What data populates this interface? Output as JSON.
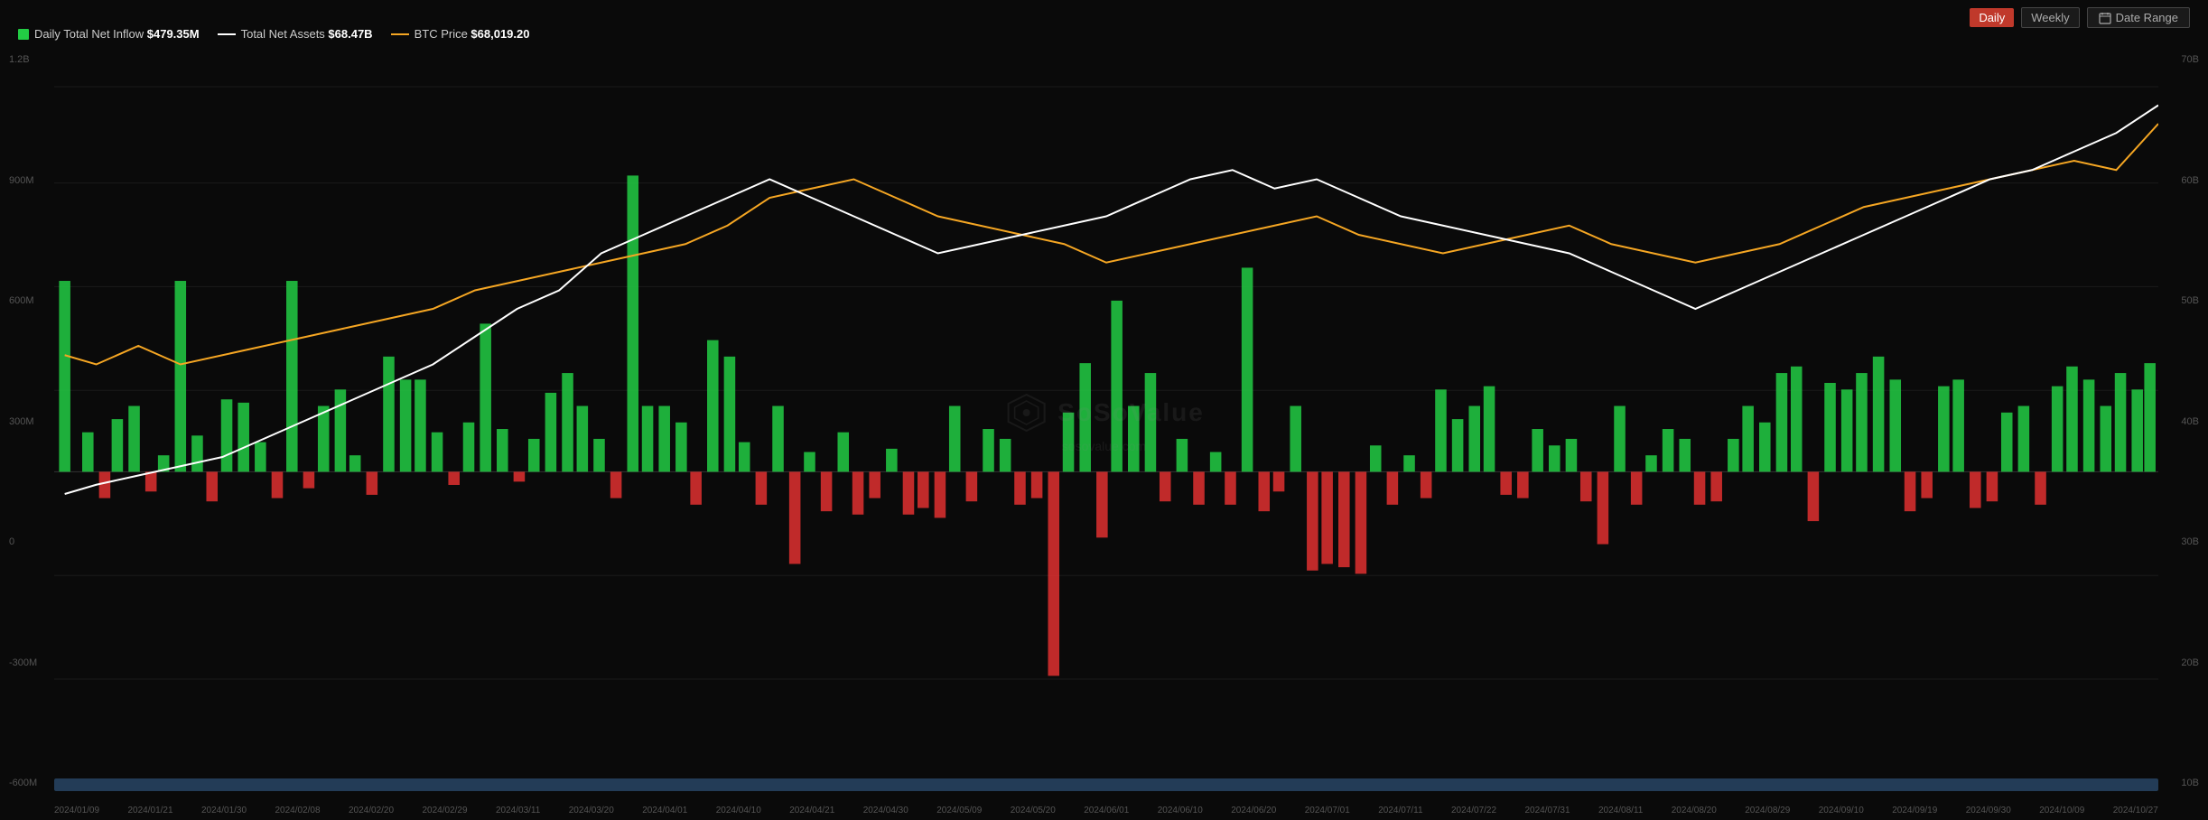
{
  "header": {
    "legend": [
      {
        "id": "inflow",
        "type": "dot",
        "color": "#22cc44",
        "label": "Daily Total Net Inflow",
        "value": "$479.35M"
      },
      {
        "id": "assets",
        "type": "line",
        "color": "#ffffff",
        "label": "Total Net Assets",
        "value": "$68.47B"
      },
      {
        "id": "btc",
        "type": "line",
        "color": "#f5a623",
        "label": "BTC Price",
        "value": "$68,019.20"
      }
    ],
    "controls": {
      "daily": "Daily",
      "weekly": "Weekly",
      "dateRange": "Date Range",
      "activeTab": "Daily"
    }
  },
  "yAxisLeft": [
    "1.2B",
    "900M",
    "600M",
    "300M",
    "0",
    "-300M",
    "-600M"
  ],
  "yAxisRight": [
    "70B",
    "60B",
    "50B",
    "40B",
    "30B",
    "20B",
    "10B"
  ],
  "xAxisLabels": [
    "2024/01/09",
    "2024/01/21",
    "2024/01/30",
    "2024/02/08",
    "2024/02/20",
    "2024/02/29",
    "2024/03/11",
    "2024/03/20",
    "2024/04/01",
    "2024/04/10",
    "2024/04/21",
    "2024/04/30",
    "2024/05/09",
    "2024/05/20",
    "2024/06/01",
    "2024/06/10",
    "2024/06/20",
    "2024/07/01",
    "2024/07/11",
    "2024/07/22",
    "2024/07/31",
    "2024/08/11",
    "2024/08/20",
    "2024/08/29",
    "2024/09/10",
    "2024/09/19",
    "2024/09/30",
    "2024/10/09",
    "2024/10/27"
  ],
  "watermark": {
    "brand": "SoSoValue",
    "website": "sosovalue.com"
  }
}
